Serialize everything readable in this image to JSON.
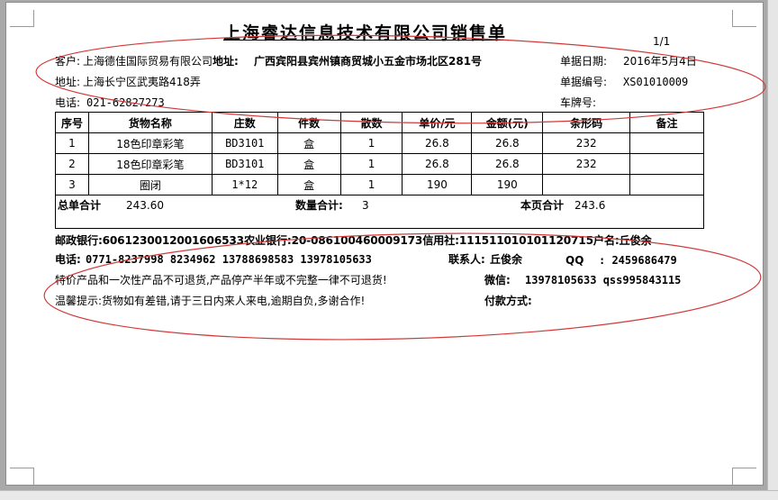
{
  "page_indicator": "1/1",
  "title": "上海睿达信息技术有限公司销售单",
  "header": {
    "customer_label": "客户:",
    "customer_value": "上海德佳国际贸易有限公司",
    "address_overlay_label": "地址:",
    "address_overlay_value": "广西宾阳县宾州镇商贸城小五金市场北区281号",
    "address_label": "地址:",
    "address_value": "上海长宁区武夷路418弄",
    "phone_label": "电话:",
    "phone_value": "021-62827273",
    "date_label": "单据日期:",
    "date_value": "2016年5月4日",
    "doc_no_label": "单据编号:",
    "doc_no_value": "XS01010009",
    "plate_label": "车牌号:",
    "plate_value": ""
  },
  "table": {
    "columns": [
      "序号",
      "货物名称",
      "庄数",
      "件数",
      "散数",
      "单价/元",
      "金额(元)",
      "条形码",
      "备注"
    ],
    "rows": [
      [
        "1",
        "18色印章彩笔",
        "BD3101",
        "盒",
        "1",
        "26.8",
        "26.8",
        "232",
        ""
      ],
      [
        "2",
        "18色印章彩笔",
        "BD3101",
        "盒",
        "1",
        "26.8",
        "26.8",
        "232",
        ""
      ],
      [
        "3",
        "圈闭",
        "1*12",
        "盒",
        "1",
        "190",
        "190",
        "",
        ""
      ]
    ]
  },
  "totals": {
    "total_label": "总单合计",
    "total_value": "243.60",
    "qty_label": "数量合计:",
    "qty_value": "3",
    "page_label": "本页合计",
    "page_value": "243.6"
  },
  "footer": {
    "bank_line": "邮政银行:6061230012001606533农业银行:20-086100460009173信用社:111511010101120715户名:丘俊余",
    "phone_line_label": "电话:",
    "phone_line_value": "0771-8237998  8234962 13788698583 13978105633",
    "contact_label": "联系人:",
    "contact_value": "丘俊余",
    "qq_label": "QQ",
    "qq_value": ": 2459686479",
    "notice_line": "特价产品和一次性产品不可退货,产品停产半年或不完整一律不可退货!",
    "wechat_label": "微信:",
    "wechat_value": "13978105633 qss995843115",
    "reminder_line": "温馨提示:货物如有差错,请于三日内来人来电,逾期自负,多谢合作!",
    "payment_label": "付款方式:"
  },
  "colors": {
    "annotation": "#d23a3a",
    "background": "#a9a9a9",
    "sheet": "#ffffff"
  }
}
